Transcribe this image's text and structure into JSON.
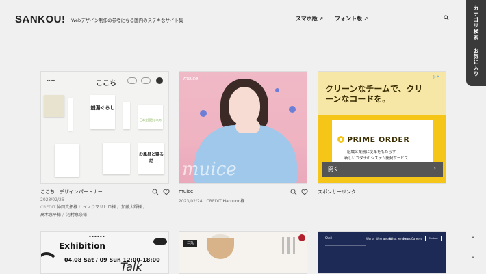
{
  "header": {
    "logo": "SANKOU!",
    "tagline": "Webデザイン制作の参考になる国内のステキなサイト集",
    "nav": [
      {
        "label": "スマホ版",
        "arrow": "↗"
      },
      {
        "label": "フォント版",
        "arrow": "↗"
      }
    ],
    "search_placeholder": ""
  },
  "side_tab": {
    "category_search": "カテゴリ検索",
    "favorites": "お気に入り"
  },
  "cards": [
    {
      "title": "ここち | デザインパートナー",
      "date": "2023/02/26",
      "credit_label": "CREDIT",
      "credits": [
        "仲岡真拓様",
        "イノウマサヒロ様",
        "加藤大輝様",
        "高木惠平様",
        "河村恵奈様"
      ],
      "thumb": {
        "logo": "ここち",
        "headline_a": "銭湯ぐらし",
        "headline_b": "日本全国生まれの",
        "headline_c": "お風呂と寝る話"
      }
    },
    {
      "title": "muice",
      "date": "2023/02/24",
      "credit_label": "CREDIT",
      "credits": [
        "Haruuno様"
      ],
      "thumb": {
        "logo": "muice",
        "big": "muice"
      }
    },
    {
      "title": "スポンサーリンク",
      "ad": {
        "headline": "クリーンなチームで、クリーンなコードを。",
        "brand": "PRIME ORDER",
        "sub1": "組織と業務に変革をもたらす",
        "sub2": "新しいカタチのシステム開発サービス",
        "cta": "開く",
        "cta_icon": "chevron-right"
      }
    }
  ],
  "row2": {
    "thumb_a": {
      "title": "Exhibition",
      "date": "04.08 Sat / 09 Sun 12:00-18:00",
      "talk": "Talk"
    },
    "thumb_b": {
      "brand": "三丸"
    },
    "thumb_c": {
      "logo": "Shell",
      "nav": [
        "Works",
        "Who we are",
        "What we do",
        "News",
        "Careers"
      ],
      "cta": "Contact"
    }
  },
  "scroll": {
    "up": "⌃",
    "down": "⌄"
  }
}
